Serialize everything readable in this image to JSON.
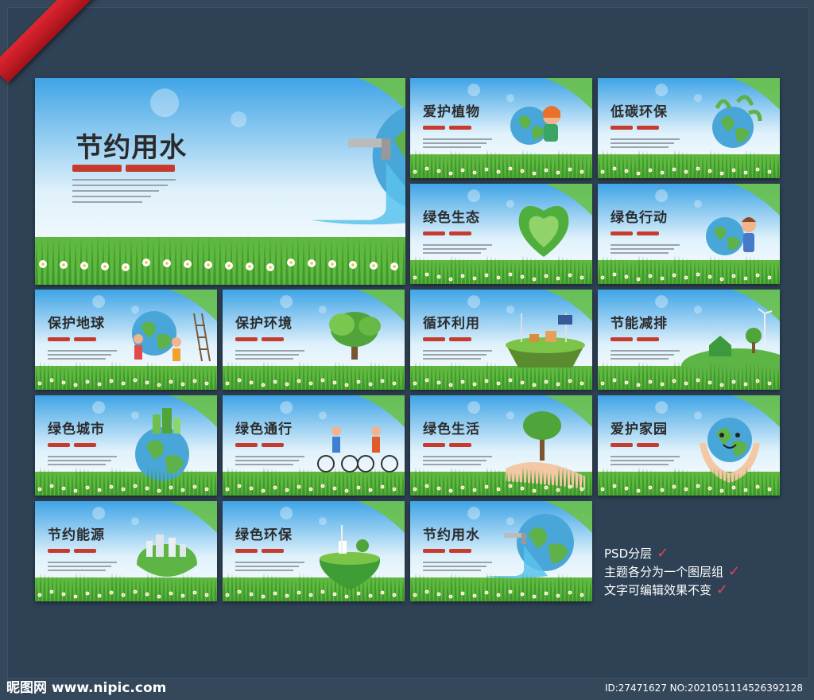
{
  "cards": [
    {
      "title": "节约用水",
      "art": "faucet-globe-icon"
    },
    {
      "title": "爱护植物",
      "art": "girl-hugging-globe-icon"
    },
    {
      "title": "低碳环保",
      "art": "leafy-globe-icon"
    },
    {
      "title": "绿色生态",
      "art": "green-heart-icon"
    },
    {
      "title": "绿色行动",
      "art": "girl-with-globe-icon"
    },
    {
      "title": "保护地球",
      "art": "people-painting-globe-icon"
    },
    {
      "title": "保护环境",
      "art": "trees-icon"
    },
    {
      "title": "循环利用",
      "art": "floating-island-icon"
    },
    {
      "title": "节能减排",
      "art": "eco-house-hill-icon"
    },
    {
      "title": "绿色城市",
      "art": "city-globe-icon"
    },
    {
      "title": "绿色通行",
      "art": "cyclists-icon"
    },
    {
      "title": "绿色生活",
      "art": "hand-holding-tree-icon"
    },
    {
      "title": "爱护家园",
      "art": "hands-holding-globe-icon"
    },
    {
      "title": "节约能源",
      "art": "city-sphere-icon"
    },
    {
      "title": "绿色环保",
      "art": "green-heart-island-icon"
    },
    {
      "title": "节约用水",
      "art": "faucet-globe-icon"
    }
  ],
  "features": [
    {
      "text": "PSD分层",
      "tick": "✓"
    },
    {
      "text": "主题各分为一个图层组",
      "tick": "✓"
    },
    {
      "text": "文字可编辑效果不变",
      "tick": "✓"
    }
  ],
  "footer": {
    "logo": "昵图网 www.nipic.com",
    "id_text": "ID:27471627 NO:20210511145263921​28"
  }
}
